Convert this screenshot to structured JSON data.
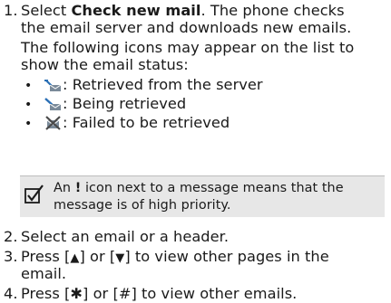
{
  "step1": {
    "number": "1.",
    "prefix": "Select ",
    "bold": "Check new mail",
    "suffix": ". The phone checks",
    "line2": "the email server and downloads new emails.",
    "line3": "The following icons may appear on the list to",
    "line4": "show the email status:"
  },
  "statuses": [
    {
      "icon": "retrieved-envelope-icon",
      "label": ": Retrieved from the server"
    },
    {
      "icon": "retrieving-envelope-icon",
      "label": ": Being retrieved"
    },
    {
      "icon": "failed-envelope-icon",
      "label": ": Failed to be retrieved"
    }
  ],
  "note": {
    "icon": "checkmark-note-icon",
    "line1_prefix": "An ",
    "line1_bold": "!",
    "line1_suffix": " icon next to a message means that the",
    "line2": "message is of high priority."
  },
  "step2": {
    "number": "2.",
    "text": "Select an email or a header."
  },
  "step3": {
    "number": "3.",
    "press": "Press [",
    "key1": "▲",
    "or": "] or [",
    "key2": "▼",
    "suffix": "] to view other pages in the",
    "line2": "email."
  },
  "step4": {
    "number": "4.",
    "press": "Press [",
    "key1": "✱",
    "or": "] or [",
    "key2": "#",
    "suffix": "] to view other emails."
  },
  "colors": {
    "text": "#1a1a1a",
    "note_background": "#e7e7e7",
    "icon_blue": "#2a6fb5"
  }
}
